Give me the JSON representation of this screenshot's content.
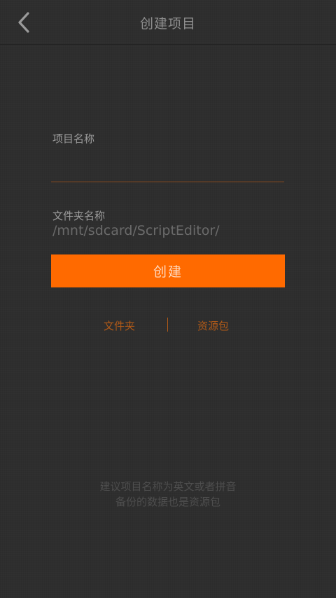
{
  "header": {
    "title": "创建项目",
    "back_icon": "chevron-left-icon"
  },
  "form": {
    "project_name_label": "项目名称",
    "project_name_value": "",
    "folder_name_label": "文件夹名称",
    "folder_path": "/mnt/sdcard/ScriptEditor/",
    "create_button_label": "创建"
  },
  "links": {
    "folder": "文件夹",
    "resource_pack": "资源包"
  },
  "hints": {
    "line1": "建议项目名称为英文或者拼音",
    "line2": "备份的数据也是资源包"
  },
  "colors": {
    "accent": "#ff6a00",
    "link": "#b15a18",
    "background": "#2e2e2e"
  }
}
